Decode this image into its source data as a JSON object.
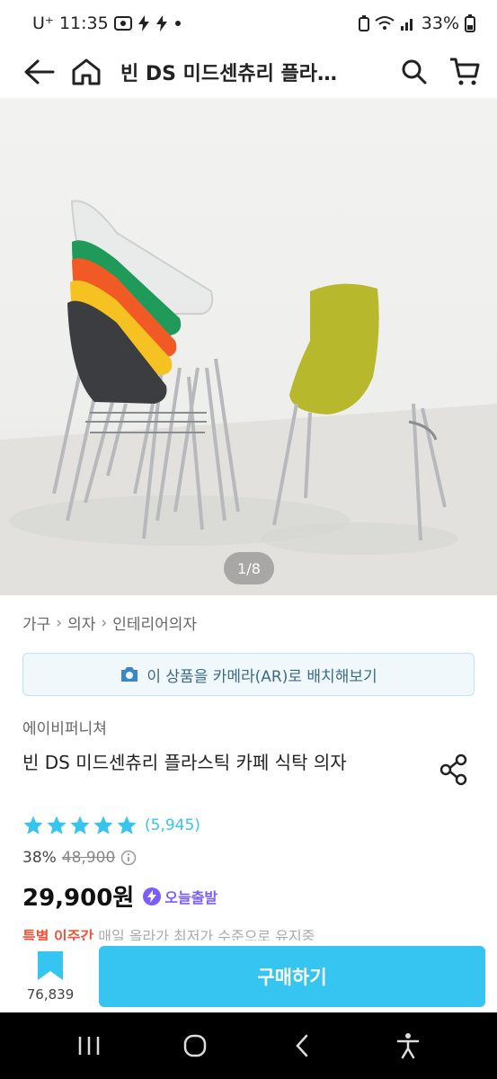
{
  "status_bar": {
    "carrier": "U⁺",
    "time": "11:35",
    "battery": "33%"
  },
  "app_bar": {
    "title": "빈 DS 미드센츄리 플라스틱 카페 식탁 의자"
  },
  "gallery": {
    "page_indicator": "1/8"
  },
  "breadcrumb": [
    "가구",
    "의자",
    "인테리어의자"
  ],
  "ar_button": {
    "label": "이 상품을 카메라(AR)로 배치해보기"
  },
  "product": {
    "brand": "에이비퍼니쳐",
    "title": "빈 DS 미드센츄리 플라스틱 카페 식탁 의자",
    "rating": {
      "stars": 5,
      "review_count": "(5,945)"
    },
    "discount": "38%",
    "original_price": "48,900",
    "price": "29,900원",
    "delivery_badge": "오늘출발",
    "promo_text": "특별 이주간",
    "promo_detail": " 매일 올라가 최저가 수준으로 유지중"
  },
  "bottom_bar": {
    "bookmark_count": "76,839",
    "buy_label": "구매하기"
  },
  "colors": {
    "accent": "#35c5f0",
    "badge": "#7b5cff",
    "promo": "#f0533a"
  }
}
